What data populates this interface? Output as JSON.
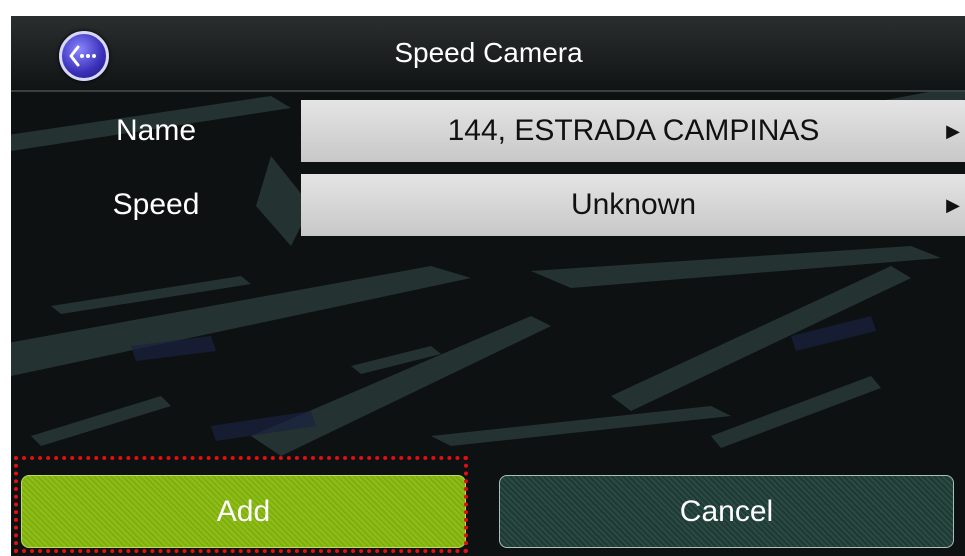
{
  "header": {
    "title": "Speed Camera",
    "back_icon": "back-menu-icon"
  },
  "fields": [
    {
      "label": "Name",
      "value": "144, ESTRADA CAMPINAS"
    },
    {
      "label": "Speed",
      "value": "Unknown"
    }
  ],
  "buttons": {
    "add_label": "Add",
    "cancel_label": "Cancel"
  },
  "colors": {
    "accent_add": "#8fbd18",
    "cancel_bg": "#2a4a42",
    "highlight": "#e01010"
  }
}
